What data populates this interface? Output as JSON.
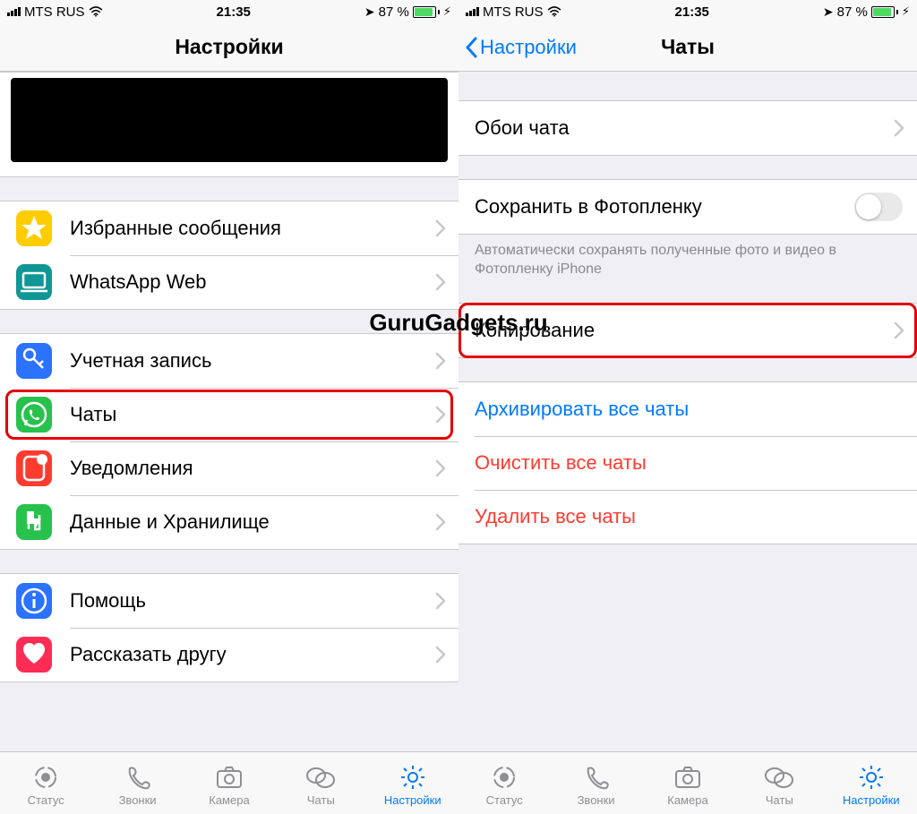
{
  "watermark": "GuruGadgets.ru",
  "status": {
    "carrier": "MTS RUS",
    "time": "21:35",
    "battery_pct": "87 %"
  },
  "left": {
    "nav_title": "Настройки",
    "group1": {
      "starred": "Избранные сообщения",
      "web": "WhatsApp Web"
    },
    "group2": {
      "account": "Учетная запись",
      "chats": "Чаты",
      "notifications": "Уведомления",
      "data": "Данные и Хранилище"
    },
    "group3": {
      "help": "Помощь",
      "tell": "Рассказать другу"
    }
  },
  "right": {
    "nav_back": "Настройки",
    "nav_title": "Чаты",
    "wallpaper": "Обои чата",
    "save_media": "Сохранить в Фотопленку",
    "save_media_hint": "Автоматически сохранять полученные фото и видео в Фотопленку iPhone",
    "backup": "Копирование",
    "archive_all": "Архивировать все чаты",
    "clear_all": "Очистить все чаты",
    "delete_all": "Удалить все чаты"
  },
  "tabs": {
    "status": "Статус",
    "calls": "Звонки",
    "camera": "Камера",
    "chats": "Чаты",
    "settings": "Настройки"
  }
}
